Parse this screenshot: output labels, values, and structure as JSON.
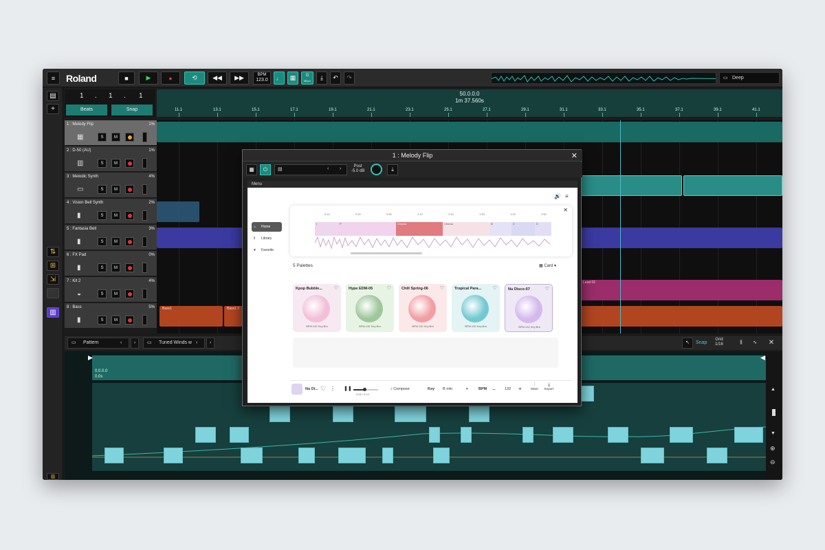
{
  "app": {
    "logo": "Roland",
    "bpm_label": "BPM",
    "bpm_value": "123.0",
    "key_letter": "G",
    "key_mode": "Minor",
    "preset": "Deep"
  },
  "transport": {
    "position": [
      "1",
      ".",
      "1",
      ".",
      "1"
    ],
    "beats_label": "Beats",
    "snap_label": "Snap",
    "ruler_bar": "50.0.0.0",
    "ruler_time": "1m 37.560s",
    "ruler_ticks": [
      "11.1",
      "13.1",
      "15.1",
      "17.1",
      "19.1",
      "21.1",
      "23.1",
      "25.1",
      "27.1",
      "29.1",
      "31.1",
      "33.1",
      "35.1",
      "37.1",
      "39.1",
      "41.1"
    ]
  },
  "tracks": [
    {
      "name": "1 : Melody Flip",
      "pct": "1%",
      "icon": "grid-icon"
    },
    {
      "name": "2 : D-50 (AU)",
      "pct": "1%",
      "icon": "piano-icon"
    },
    {
      "name": "3 : Melodic Synth",
      "pct": "4%",
      "icon": "keyboard-icon"
    },
    {
      "name": "4 : Vision Bell Synth",
      "pct": "2%",
      "icon": "bars-icon"
    },
    {
      "name": "5 : Fantasia Bell",
      "pct": "3%",
      "icon": "bars-icon"
    },
    {
      "name": "6 : FX Pad",
      "pct": "0%",
      "icon": "bars-icon"
    },
    {
      "name": "7 : Kit 2",
      "pct": "4%",
      "icon": "drum-icon"
    },
    {
      "name": "8 : Bass",
      "pct": "5%",
      "icon": "bars-icon"
    }
  ],
  "track_buttons": {
    "solo": "S",
    "mute": "M"
  },
  "clips": {
    "bass1": "Bass1",
    "bass1_2": "Bass1 2",
    "lead": "Lead 02"
  },
  "midbar": {
    "pattern_label": "Pattern",
    "instrument": "Tuned Winds w",
    "snap": "Snap",
    "grid_label": "Grid",
    "grid_value": "1/16"
  },
  "pattern_editor": {
    "pos_bar": "0.0.0.0",
    "pos_time": "0.0s"
  },
  "dialog": {
    "title": "1 : Melody Flip",
    "post_label": "Post",
    "gain": "-5.0 dB",
    "menu_label": "Menu",
    "nav": [
      "Home",
      "Library",
      "Favorite"
    ],
    "timeline_ticks": [
      "0:10",
      "0:20",
      "0:30",
      "1:10",
      "1:20",
      "1:30",
      "1:40",
      "1:50"
    ],
    "sections": [
      "I",
      "P",
      "Chorus",
      "Chorus",
      "B",
      "C",
      "D"
    ],
    "palettes_count": "5 Palettes",
    "view_mode": "Card",
    "palettes": [
      {
        "title": "Kpop Bubble...",
        "meta": "BPM:132 Key:Bm",
        "bg": "#f7e9f1",
        "circle": "#f3bfd8"
      },
      {
        "title": "Hype EDM-05",
        "meta": "BPM:132 Key:Bm",
        "bg": "#e8f4e3",
        "circle": "#9fc79b"
      },
      {
        "title": "Chill Spring-06",
        "meta": "BPM:132 Key:Bm",
        "bg": "#fbe9ea",
        "circle": "#f29ea4"
      },
      {
        "title": "Tropical Para...",
        "meta": "BPM:132 Key:Bm",
        "bg": "#e4f3f4",
        "circle": "#73c9d1"
      },
      {
        "title": "Nu Disco-07",
        "meta": "BPM:132 Key:Bm",
        "bg": "#efe9f6",
        "circle": "#d4b8ee"
      }
    ],
    "player": {
      "name": "Nu Di...",
      "time": "0:05 / 0:14",
      "compose": "Compose",
      "key_label": "Key",
      "key_value": "B min",
      "bpm_label": "BPM",
      "bpm_value": "132",
      "mixer": "Mixer",
      "export": "Export"
    }
  },
  "colors": {
    "teal": "#1d8a80",
    "accent_cyan": "#7fd3dc",
    "record_red": "#e0343c"
  }
}
